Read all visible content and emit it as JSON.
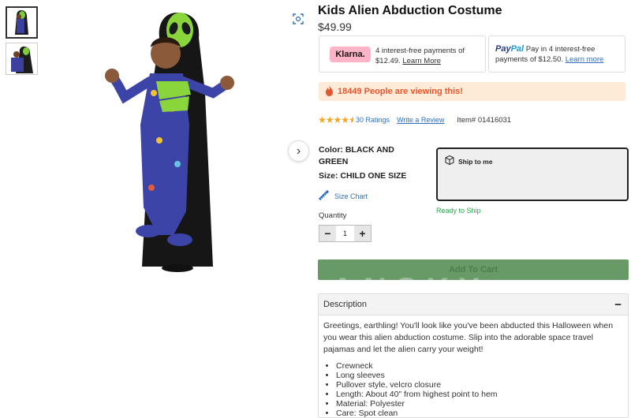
{
  "product": {
    "title": "Kids Alien Abduction Costume",
    "price": "$49.99",
    "item_number": "Item# 01416031"
  },
  "payments": {
    "klarna": {
      "logo": "Klarna.",
      "line1": "4 interest-free payments of",
      "line2_amount": "$12.49.",
      "learn_more": "Learn More"
    },
    "paypal": {
      "logo_pay": "Pay",
      "logo_pal": "Pal",
      "text": "Pay in 4 interest-free payments of $12.50.",
      "learn_more": "Learn more"
    }
  },
  "viewing": {
    "text": "18449 People are viewing this!",
    "icon": "flame-icon"
  },
  "ratings": {
    "stars_value": 4.5,
    "count_label": "30 Ratings",
    "write_review": "Write a Review",
    "star_color": "#f5a623"
  },
  "options": {
    "color": "Color: BLACK AND GREEN",
    "size": "Size: CHILD ONE SIZE",
    "size_chart": "Size Chart"
  },
  "shipping": {
    "ship_to_me": "Ship to me",
    "ready": "Ready to Ship"
  },
  "quantity": {
    "label": "Quantity",
    "value": "1",
    "minus": "−",
    "plus": "+"
  },
  "cart": {
    "add_label": "Add To Cart",
    "button_color": "#679a67"
  },
  "watermark": "ANSKY",
  "description": {
    "header": "Description",
    "toggle": "−",
    "intro": "Greetings, earthling! You'll look like you've been abducted this Halloween when you wear this alien abduction costume. Slip into the adorable space travel pajamas and let the alien carry your weight!",
    "bullets": [
      "Crewneck",
      "Long sleeves",
      "Pullover style, velcro closure",
      "Length: About 40\" from highest point to hem",
      "Material: Polyester",
      "Care: Spot clean"
    ]
  },
  "colors": {
    "link": "#2f6fbe",
    "alert_bg": "#fdebd8",
    "alert_text": "#e4572e",
    "ready_green": "#2aa64b"
  }
}
